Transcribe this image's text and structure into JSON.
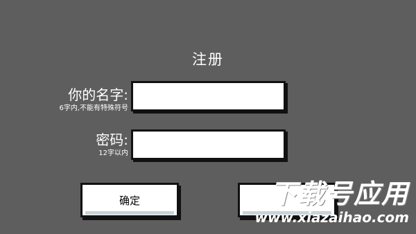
{
  "form": {
    "title": "注册",
    "name": {
      "label": "你的名字:",
      "hint": "6字内,不能有特殊符号",
      "value": ""
    },
    "password": {
      "label": "密码:",
      "hint": "12字以内",
      "value": ""
    },
    "confirm_label": "确定",
    "cancel_label": ""
  },
  "watermark": {
    "main": "下载号应用",
    "url": "www.xiazaihao.com"
  }
}
